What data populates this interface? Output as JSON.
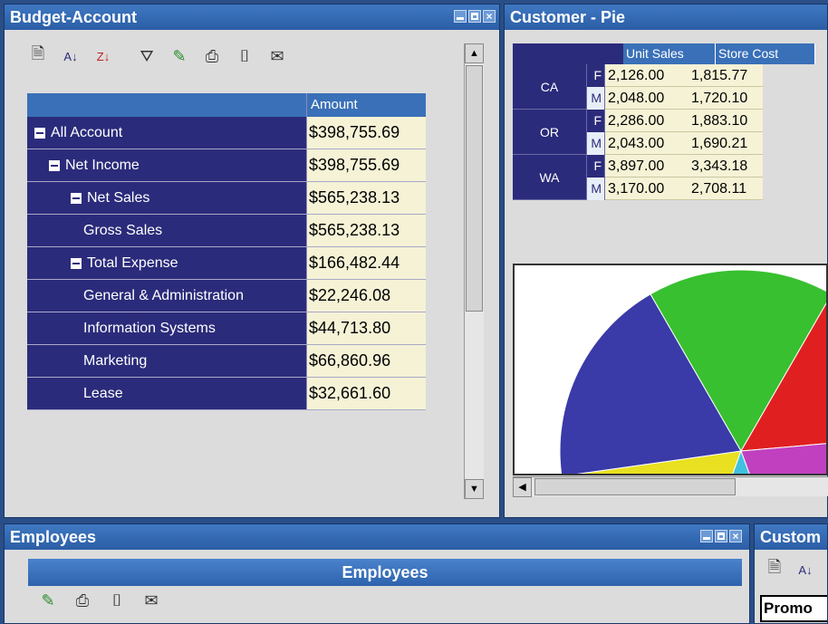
{
  "budget": {
    "title": "Budget-Account",
    "header_amount": "Amount",
    "rows": [
      {
        "label": "All Account",
        "amount": "$398,755.69",
        "indent": 0,
        "collapsible": true
      },
      {
        "label": "Net Income",
        "amount": "$398,755.69",
        "indent": 1,
        "collapsible": true
      },
      {
        "label": "Net Sales",
        "amount": "$565,238.13",
        "indent": 2,
        "collapsible": true
      },
      {
        "label": "Gross Sales",
        "amount": "$565,238.13",
        "indent": 3,
        "collapsible": false
      },
      {
        "label": "Total Expense",
        "amount": "$166,482.44",
        "indent": 2,
        "collapsible": true
      },
      {
        "label": "General & Administration",
        "amount": "$22,246.08",
        "indent": 3,
        "collapsible": false
      },
      {
        "label": "Information Systems",
        "amount": "$44,713.80",
        "indent": 3,
        "collapsible": false
      },
      {
        "label": "Marketing",
        "amount": "$66,860.96",
        "indent": 3,
        "collapsible": false
      },
      {
        "label": "Lease",
        "amount": "$32,661.60",
        "indent": 3,
        "collapsible": false
      }
    ],
    "toolbar_icons": [
      "properties-icon",
      "sort-ascending-icon",
      "sort-descending-icon",
      "top-ten-filter-icon",
      "export-excel-icon",
      "print-icon",
      "snapshot-camera-icon",
      "email-icon"
    ]
  },
  "customer_pie": {
    "title": "Customer - Pie",
    "columns": [
      "Unit Sales",
      "Store Cost"
    ],
    "states": [
      {
        "state": "CA",
        "rows": [
          {
            "gender": "F",
            "unit_sales": "2,126.00",
            "store_cost": "1,815.77"
          },
          {
            "gender": "M",
            "unit_sales": "2,048.00",
            "store_cost": "1,720.10"
          }
        ]
      },
      {
        "state": "OR",
        "rows": [
          {
            "gender": "F",
            "unit_sales": "2,286.00",
            "store_cost": "1,883.10"
          },
          {
            "gender": "M",
            "unit_sales": "2,043.00",
            "store_cost": "1,690.21"
          }
        ]
      },
      {
        "state": "WA",
        "rows": [
          {
            "gender": "F",
            "unit_sales": "3,897.00",
            "store_cost": "3,343.18"
          },
          {
            "gender": "M",
            "unit_sales": "3,170.00",
            "store_cost": "2,708.11"
          }
        ]
      }
    ],
    "pie_colors": [
      "#e8e020",
      "#3a3aa8",
      "#38c030",
      "#e02020",
      "#c040c0",
      "#40c0e0"
    ]
  },
  "employees": {
    "title": "Employees",
    "header": "Employees",
    "toolbar_icons": [
      "export-excel-icon",
      "print-icon",
      "snapshot-camera-icon",
      "email-icon"
    ]
  },
  "customer2": {
    "title": "Custom",
    "first_cell": "Promo"
  }
}
